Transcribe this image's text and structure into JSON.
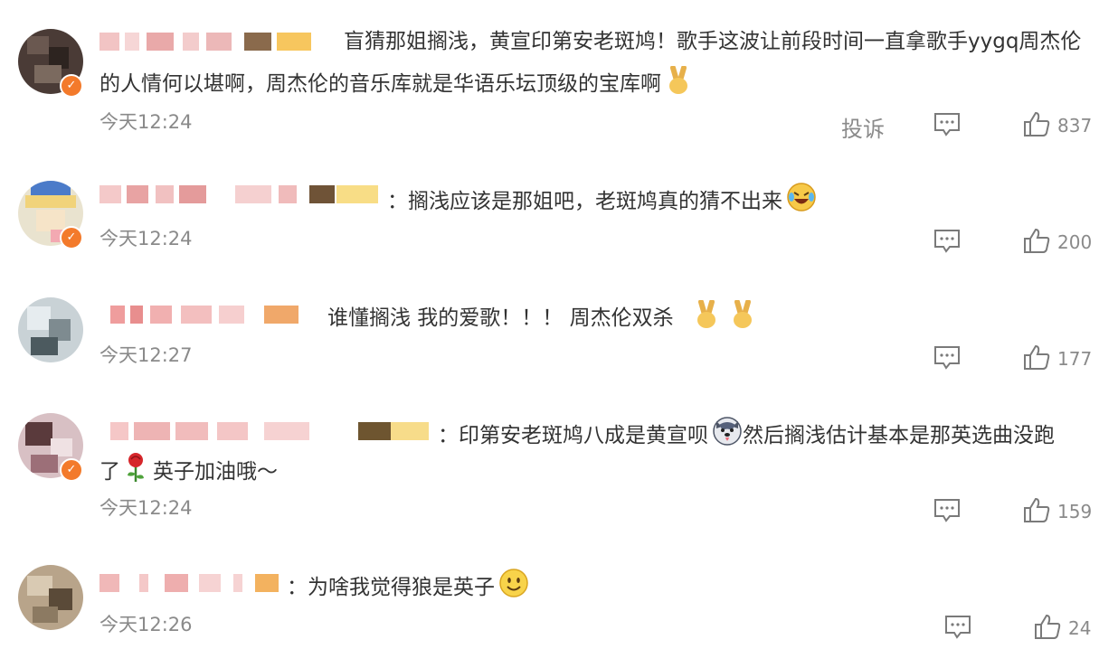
{
  "comments": [
    {
      "text_line1": "盲猜那姐搁浅，黄宣印第安老斑鸠！歌手这波让前段时间一直拿歌手yygq周杰伦",
      "text_line2": "的人情何以堪啊，周杰伦的音乐库就是华语乐坛顶级的宝库啊",
      "time": "今天12:24",
      "report": "投诉",
      "likes": "837"
    },
    {
      "text_line1": "：搁浅应该是那姐吧，老斑鸠真的猜不出来",
      "time": "今天12:24",
      "likes": "200"
    },
    {
      "text_line1": "谁懂搁浅 我的爱歌！！！ 周杰伦双杀",
      "time": "今天12:27",
      "likes": "177"
    },
    {
      "text_line1": "：印第安老斑鸠八成是黄宣呗",
      "text_line1b": "然后搁浅估计基本是那英选曲没跑",
      "text_line2_a": "了",
      "text_line2_b": "英子加油哦～",
      "time": "今天12:24",
      "likes": "159"
    },
    {
      "text_line1": "：为啥我觉得狼是英子",
      "time": "今天12:26",
      "likes": "24"
    }
  ],
  "icons": {
    "reply": "comment-bubble-icon",
    "like": "thumbs-up-icon",
    "victory": "victory-hand-emoji",
    "laugh_cry": "rolling-laughing-emoji",
    "husky": "husky-dog-emoji",
    "rose": "rose-emoji",
    "smile": "smiley-emoji"
  },
  "colors": {
    "text": "#333333",
    "meta": "#8a8a8a",
    "badge": "#f37a2b"
  }
}
